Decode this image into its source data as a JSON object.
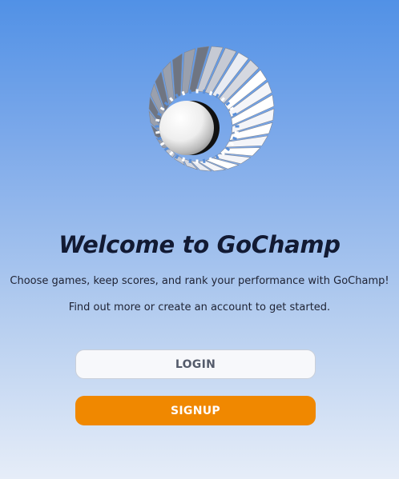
{
  "logo": {
    "icon": "shuttlecock-icon"
  },
  "welcome": {
    "title": "Welcome to GoChamp",
    "line1": "Choose games, keep scores, and rank your performance with GoChamp!",
    "line2": "Find out more or create an account to get started."
  },
  "buttons": {
    "login_label": "LOGIN",
    "signup_label": "SIGNUP"
  },
  "colors": {
    "accent": "#f08800",
    "title": "#121a33",
    "background_top": "#5191e6",
    "background_bottom": "#e6edf8"
  }
}
